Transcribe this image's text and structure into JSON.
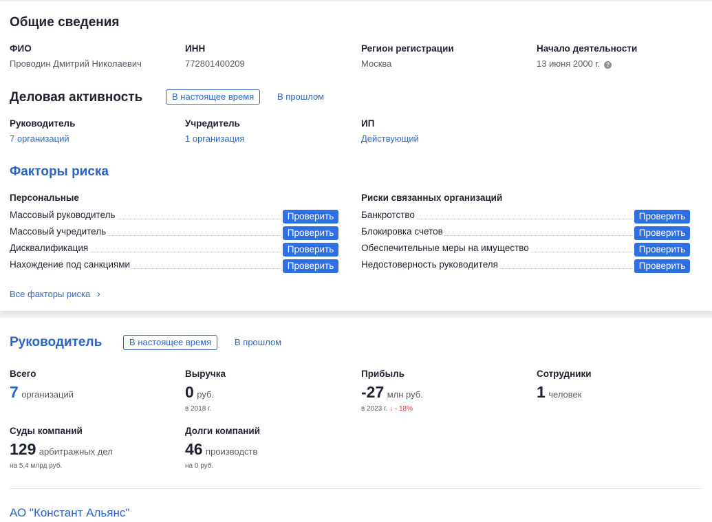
{
  "general": {
    "title": "Общие сведения",
    "fio_label": "ФИО",
    "fio_value": "Проводин Дмитрий Николаевич",
    "inn_label": "ИНН",
    "inn_value": "772801400209",
    "region_label": "Регион регистрации",
    "region_value": "Москва",
    "start_label": "Начало деятельности",
    "start_value": "13 июня 2000 г.",
    "help_glyph": "?"
  },
  "activity": {
    "title": "Деловая активность",
    "tab_now": "В настоящее время",
    "tab_past": "В прошлом",
    "manager_label": "Руководитель",
    "manager_value": "7 организаций",
    "founder_label": "Учредитель",
    "founder_value": "1 организация",
    "ip_label": "ИП",
    "ip_value": "Действующий"
  },
  "risk": {
    "title": "Факторы риска",
    "personal_label": "Персональные",
    "related_label": "Риски связанных организаций",
    "check_label": "Проверить",
    "personal": [
      "Массовый руководитель",
      "Массовый учредитель",
      "Дисквалификация",
      "Нахождение под санкциями"
    ],
    "related": [
      "Банкротство",
      "Блокировка счетов",
      "Обеспечительные меры на имущество",
      "Недостоверность руководителя"
    ],
    "all_link": "Все факторы риска",
    "chevron": "›"
  },
  "leader": {
    "title": "Руководитель",
    "tab_now": "В настоящее время",
    "tab_past": "В прошлом",
    "total_label": "Всего",
    "total_num": "7",
    "total_unit": "организаций",
    "revenue_label": "Выручка",
    "revenue_num": "0",
    "revenue_unit": "руб.",
    "revenue_note": "в 2018 г.",
    "profit_label": "Прибыль",
    "profit_num": "-27",
    "profit_unit": "млн руб.",
    "profit_note": "в 2023 г.",
    "profit_change_arrow": "↓",
    "profit_change": "- 18%",
    "staff_label": "Сотрудники",
    "staff_num": "1",
    "staff_unit": "человек",
    "courts_label": "Суды компаний",
    "courts_num": "129",
    "courts_unit": "арбитражных дел",
    "courts_note": "на 5,4 млрд руб.",
    "debts_label": "Долги компаний",
    "debts_num": "46",
    "debts_unit": "производств",
    "debts_note": "на 0 руб.",
    "company_name": "АО \"Констант Альянс\""
  },
  "colors": {
    "accent": "#2f66c6",
    "button": "#2f6fe0",
    "negative": "#e0352f"
  }
}
